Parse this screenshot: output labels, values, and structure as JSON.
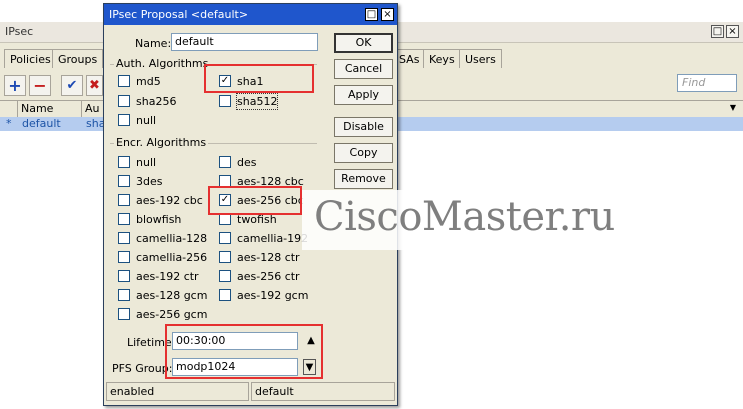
{
  "bg_window": {
    "title": "IPsec",
    "tabs": [
      "Policies",
      "Groups",
      "SAs",
      "Keys",
      "Users"
    ],
    "find_placeholder": "Find",
    "columns": [
      "Name",
      "Au"
    ],
    "row": {
      "marker": "*",
      "name": "default",
      "auth": "sha"
    }
  },
  "dialog": {
    "title": "IPsec Proposal <default>",
    "name_label": "Name:",
    "name_value": "default",
    "auth_group": "Auth. Algorithms",
    "auth_algorithms": [
      {
        "label": "md5",
        "checked": false
      },
      {
        "label": "sha1",
        "checked": true
      },
      {
        "label": "sha256",
        "checked": false
      },
      {
        "label": "sha512",
        "checked": false
      },
      {
        "label": "null",
        "checked": false
      }
    ],
    "encr_group": "Encr. Algorithms",
    "encr_algorithms": [
      {
        "label": "null",
        "checked": false
      },
      {
        "label": "des",
        "checked": false
      },
      {
        "label": "3des",
        "checked": false
      },
      {
        "label": "aes-128 cbc",
        "checked": false
      },
      {
        "label": "aes-192 cbc",
        "checked": false
      },
      {
        "label": "aes-256 cbc",
        "checked": true
      },
      {
        "label": "blowfish",
        "checked": false
      },
      {
        "label": "twofish",
        "checked": false
      },
      {
        "label": "camellia-128",
        "checked": false
      },
      {
        "label": "camellia-192",
        "checked": false
      },
      {
        "label": "camellia-256",
        "checked": false
      },
      {
        "label": "aes-128 ctr",
        "checked": false
      },
      {
        "label": "aes-192 ctr",
        "checked": false
      },
      {
        "label": "aes-256 ctr",
        "checked": false
      },
      {
        "label": "aes-128 gcm",
        "checked": false
      },
      {
        "label": "aes-192 gcm",
        "checked": false
      },
      {
        "label": "aes-256 gcm",
        "checked": false
      }
    ],
    "lifetime_label": "Lifetime:",
    "lifetime_value": "00:30:00",
    "pfs_label": "PFS Group:",
    "pfs_value": "modp1024",
    "buttons": {
      "ok": "OK",
      "cancel": "Cancel",
      "apply": "Apply",
      "disable": "Disable",
      "copy": "Copy",
      "remove": "Remove"
    },
    "status_left": "enabled",
    "status_right": "default"
  },
  "watermark": "CiscoMaster.ru",
  "colors": {
    "titlebar": "#1f56cc",
    "highlight": "#e53030",
    "selection": "#b5ccef"
  }
}
